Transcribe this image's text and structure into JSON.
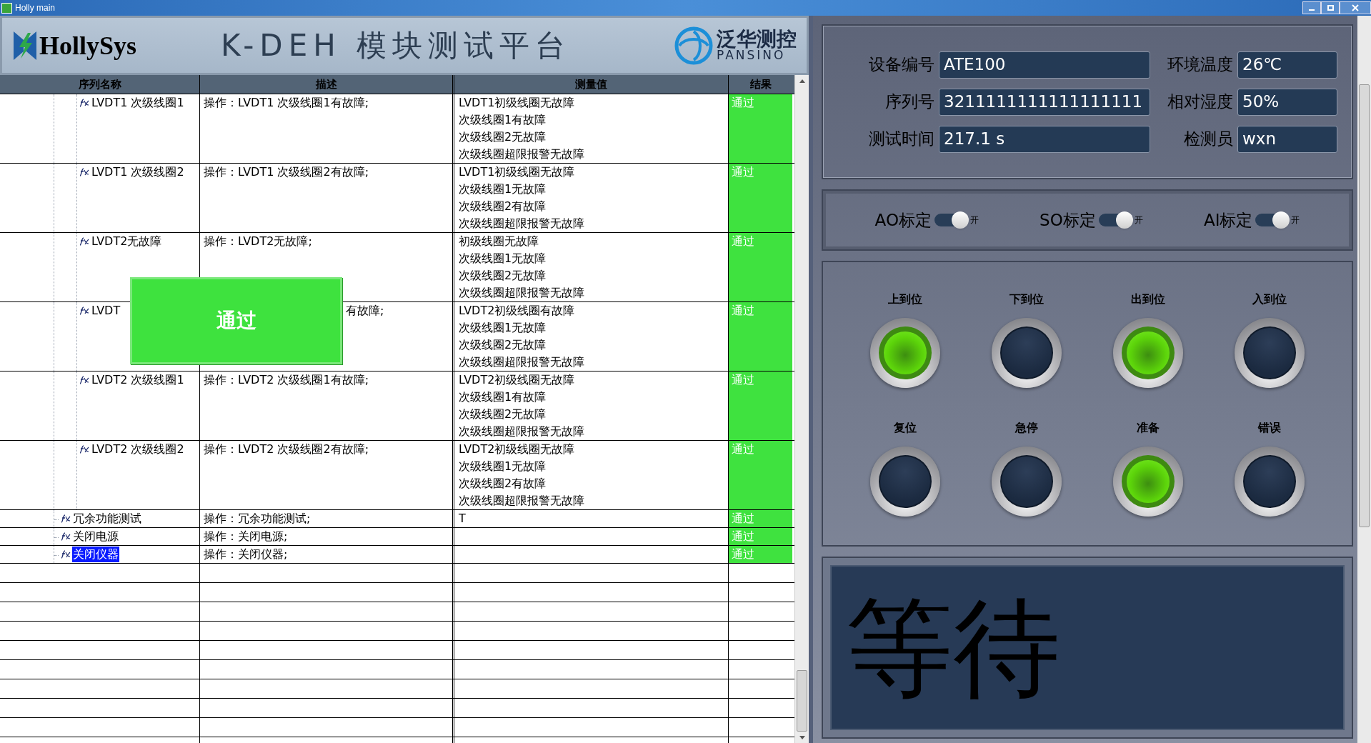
{
  "window": {
    "title": "Holly main"
  },
  "header": {
    "brand": "HollySys",
    "title": "K-DEH 模块测试平台",
    "partner_name": "泛华测控",
    "partner_latin": "PANSINO"
  },
  "table": {
    "columns": [
      "序列名称",
      "描述",
      "测量值",
      "结果"
    ],
    "rows": [
      {
        "kind": "sub_step",
        "name": "LVDT1 次级线圈1",
        "description": "操作：LVDT1 次级线圈1有故障;",
        "measurements": [
          "LVDT1初级线圈无故障",
          "次级线圈1有故障",
          "次级线圈2无故障",
          "次级线圈超限报警无故障"
        ],
        "result": "通过",
        "passed": true,
        "selected": false,
        "obscured": false
      },
      {
        "kind": "sub_step",
        "name": "LVDT1 次级线圈2",
        "description": "操作：LVDT1 次级线圈2有故障;",
        "measurements": [
          "LVDT1初级线圈无故障",
          "次级线圈1无故障",
          "次级线圈2有故障",
          "次级线圈超限报警无故障"
        ],
        "result": "通过",
        "passed": true,
        "selected": false,
        "obscured": false
      },
      {
        "kind": "sub_step",
        "name": "LVDT2无故障",
        "description": "操作：LVDT2无故障;",
        "measurements": [
          "初级线圈无故障",
          "次级线圈1无故障",
          "次级线圈2无故障",
          "次级线圈超限报警无故障"
        ],
        "result": "通过",
        "passed": true,
        "selected": false,
        "obscured": false
      },
      {
        "kind": "sub_step",
        "name": "LVDT",
        "description": "有故障;",
        "measurements": [
          "LVDT2初级线圈有故障",
          "次级线圈1无故障",
          "次级线圈2无故障",
          "次级线圈超限报警无故障"
        ],
        "result": "通过",
        "passed": true,
        "selected": false,
        "obscured": true
      },
      {
        "kind": "sub_step",
        "name": "LVDT2 次级线圈1",
        "description": "操作：LVDT2 次级线圈1有故障;",
        "measurements": [
          "LVDT2初级线圈无故障",
          "次级线圈1有故障",
          "次级线圈2无故障",
          "次级线圈超限报警无故障"
        ],
        "result": "通过",
        "passed": true,
        "selected": false,
        "obscured": false
      },
      {
        "kind": "sub_step",
        "name": "LVDT2 次级线圈2",
        "description": "操作：LVDT2 次级线圈2有故障;",
        "measurements": [
          "LVDT2初级线圈无故障",
          "次级线圈1无故障",
          "次级线圈2有故障",
          "次级线圈超限报警无故障"
        ],
        "result": "通过",
        "passed": true,
        "selected": false,
        "obscured": false
      },
      {
        "kind": "step",
        "name": "冗余功能测试",
        "description": "操作：冗余功能测试;",
        "measurements": [
          "T"
        ],
        "result": "通过",
        "passed": true,
        "selected": false,
        "obscured": false
      },
      {
        "kind": "step",
        "name": "关闭电源",
        "description": "操作：关闭电源;",
        "measurements": [],
        "result": "通过",
        "passed": true,
        "selected": false,
        "obscured": false
      },
      {
        "kind": "step",
        "name": "关闭仪器",
        "description": "操作：关闭仪器;",
        "measurements": [],
        "result": "通过",
        "passed": true,
        "selected": true,
        "obscured": false
      }
    ]
  },
  "popup": {
    "text": "通过"
  },
  "info": {
    "fields": [
      {
        "label": "设备编号",
        "value": "ATE100"
      },
      {
        "label": "环境温度",
        "value": "26℃"
      },
      {
        "label": "序列号",
        "value": "3211111111111111111"
      },
      {
        "label": "相对湿度",
        "value": "50%"
      },
      {
        "label": "测试时间",
        "value": "217.1 s"
      },
      {
        "label": "检测员",
        "value": "wxn"
      }
    ]
  },
  "toggles": [
    {
      "label": "AO标定",
      "on": true,
      "state_text": "开"
    },
    {
      "label": "SO标定",
      "on": true,
      "state_text": "开"
    },
    {
      "label": "AI标定",
      "on": true,
      "state_text": "开"
    }
  ],
  "lamps": [
    {
      "label": "上到位",
      "on": true
    },
    {
      "label": "下到位",
      "on": false
    },
    {
      "label": "出到位",
      "on": true
    },
    {
      "label": "入到位",
      "on": false
    },
    {
      "label": "复位",
      "on": false
    },
    {
      "label": "急停",
      "on": false
    },
    {
      "label": "准备",
      "on": true
    },
    {
      "label": "错误",
      "on": false
    }
  ],
  "status_display": {
    "text": "等待"
  }
}
